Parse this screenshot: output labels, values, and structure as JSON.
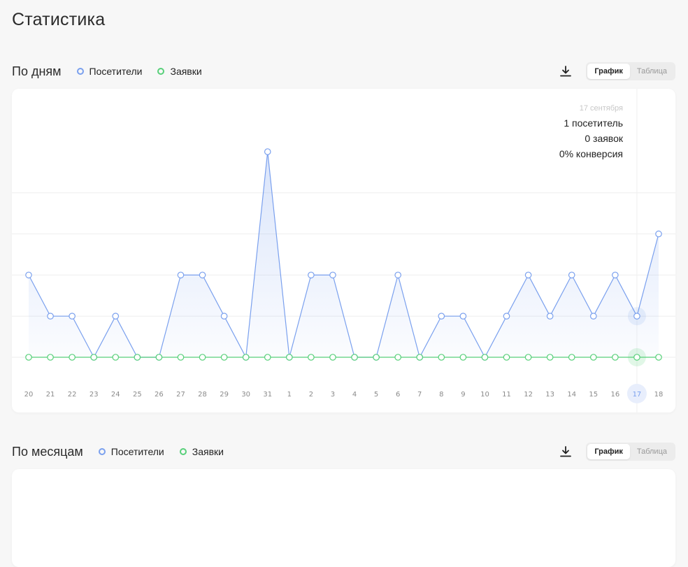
{
  "page_title": "Статистика",
  "sections": [
    {
      "title": "По дням",
      "legend": {
        "visitors": "Посетители",
        "requests": "Заявки"
      },
      "view_toggle": {
        "chart": "График",
        "table": "Таблица",
        "active": "chart"
      }
    },
    {
      "title": "По месяцам",
      "legend": {
        "visitors": "Посетители",
        "requests": "Заявки"
      },
      "view_toggle": {
        "chart": "График",
        "table": "Таблица",
        "active": "chart"
      }
    }
  ],
  "tooltip": {
    "date": "17 сентября",
    "visitors": "1 посетитель",
    "requests": "0 заявок",
    "conversion": "0% конверсия"
  },
  "colors": {
    "visitors": "#7aa0ee",
    "requests": "#58d07a",
    "grid": "#eeeeee",
    "highlight": "#e8eefc"
  },
  "icons": {
    "download": "download-icon"
  },
  "chart_data": {
    "type": "line",
    "categories": [
      "20",
      "21",
      "22",
      "23",
      "24",
      "25",
      "26",
      "27",
      "28",
      "29",
      "30",
      "31",
      "1",
      "2",
      "3",
      "4",
      "5",
      "6",
      "7",
      "8",
      "9",
      "10",
      "11",
      "12",
      "13",
      "14",
      "15",
      "16",
      "17",
      "18"
    ],
    "series": [
      {
        "name": "Посетители",
        "values": [
          2,
          1,
          1,
          0,
          1,
          0,
          0,
          2,
          2,
          1,
          0,
          5,
          0,
          2,
          2,
          0,
          0,
          2,
          0,
          1,
          1,
          0,
          1,
          2,
          1,
          2,
          1,
          2,
          1,
          3
        ]
      },
      {
        "name": "Заявки",
        "values": [
          0,
          0,
          0,
          0,
          0,
          0,
          0,
          0,
          0,
          0,
          0,
          0,
          0,
          0,
          0,
          0,
          0,
          0,
          0,
          0,
          0,
          0,
          0,
          0,
          0,
          0,
          0,
          0,
          0,
          0
        ]
      }
    ],
    "ylim": [
      0,
      8
    ],
    "highlighted_category": "17",
    "grid": true,
    "legend_placement": "top-left"
  }
}
